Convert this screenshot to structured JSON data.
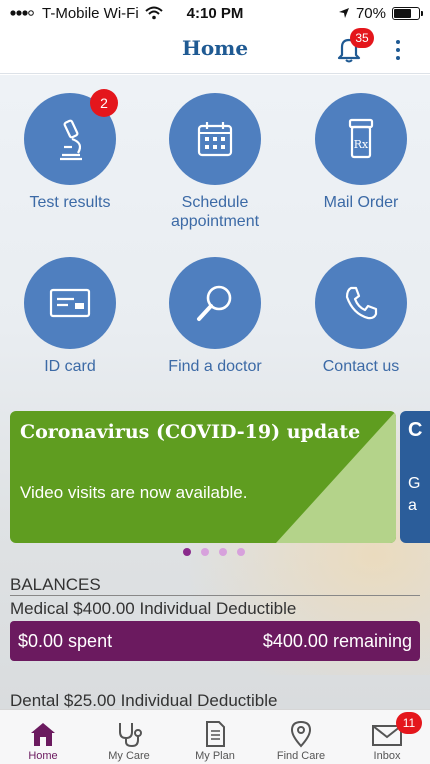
{
  "status_bar": {
    "carrier": "T-Mobile Wi-Fi",
    "time": "4:10 PM",
    "battery_text": "70%",
    "battery_level": 0.7
  },
  "header": {
    "title": "Home",
    "notification_count": "35"
  },
  "quick_actions": [
    {
      "label": "Test results",
      "icon": "microscope-icon",
      "badge": "2"
    },
    {
      "label": "Schedule appointment",
      "icon": "calendar-icon"
    },
    {
      "label": "Mail Order",
      "icon": "prescription-bottle-icon"
    },
    {
      "label": "ID card",
      "icon": "id-card-icon"
    },
    {
      "label": "Find a doctor",
      "icon": "search-icon"
    },
    {
      "label": "Contact us",
      "icon": "phone-icon"
    }
  ],
  "carousel": {
    "cards": [
      {
        "title": "Coronavirus (COVID-19) update",
        "body": "Video visits are now available."
      },
      {
        "title": "C",
        "body_line1": "G",
        "body_line2": "a"
      }
    ],
    "dot_count": 4,
    "active_index": 0
  },
  "balances": {
    "heading": "BALANCES",
    "medical_label": "Medical $400.00 Individual Deductible",
    "medical_spent": "$0.00 spent",
    "medical_remaining": "$400.00 remaining",
    "dental_label": "Dental $25.00 Individual Deductible"
  },
  "tabbar": {
    "tabs": [
      {
        "label": "Home",
        "icon": "home-icon",
        "active": true
      },
      {
        "label": "My Care",
        "icon": "stethoscope-icon"
      },
      {
        "label": "My Plan",
        "icon": "document-icon"
      },
      {
        "label": "Find Care",
        "icon": "location-pin-icon"
      },
      {
        "label": "Inbox",
        "icon": "mail-icon",
        "badge": "11"
      }
    ]
  },
  "colors": {
    "brand_blue": "#1f5a93",
    "action_blue": "#4f7fbf",
    "plum": "#6b1a5f",
    "covid_green": "#5f9d20",
    "badge_red": "#e4161c"
  }
}
